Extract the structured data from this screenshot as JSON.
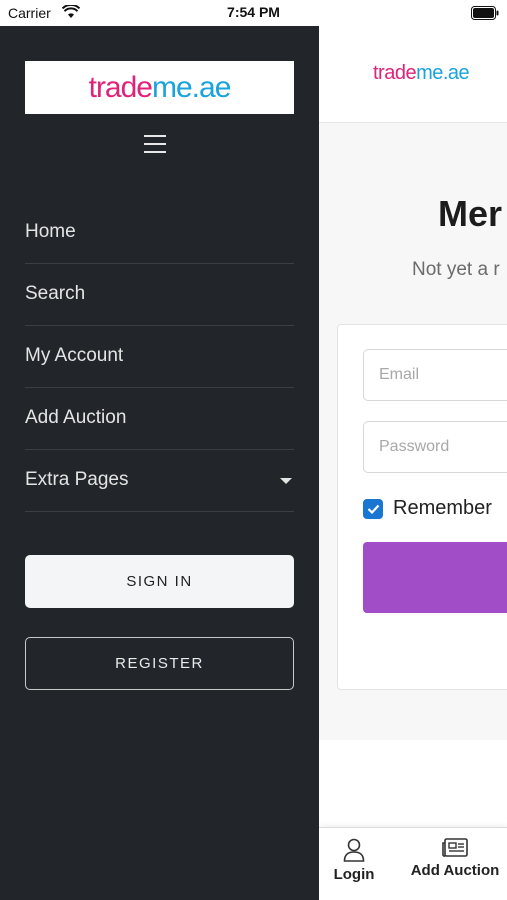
{
  "status_bar": {
    "carrier": "Carrier",
    "time": "7:54 PM"
  },
  "brand": {
    "logo_part1": "trade",
    "logo_part2": "me.ae",
    "color_pink": "#e0237a",
    "color_blue": "#1aa3dc"
  },
  "drawer": {
    "menu_icon": "hamburger-icon",
    "nav_items": [
      {
        "label": "Home"
      },
      {
        "label": "Search"
      },
      {
        "label": "My Account"
      },
      {
        "label": "Add Auction"
      },
      {
        "label": "Extra Pages",
        "has_dropdown": true
      }
    ],
    "signin_label": "SIGN IN",
    "register_label": "REGISTER",
    "background_color": "#22262a"
  },
  "page": {
    "title_visible": "Mer",
    "subtitle_visible": "Not yet a r",
    "email_placeholder": "Email",
    "password_placeholder": "Password",
    "remember_label": "Remember",
    "remember_checked": true,
    "button_color": "#a24dc8"
  },
  "tab_bar": {
    "tabs": [
      {
        "label": "Login",
        "icon": "person-icon"
      },
      {
        "label": "Add Auction",
        "icon": "newspaper-icon"
      }
    ]
  }
}
